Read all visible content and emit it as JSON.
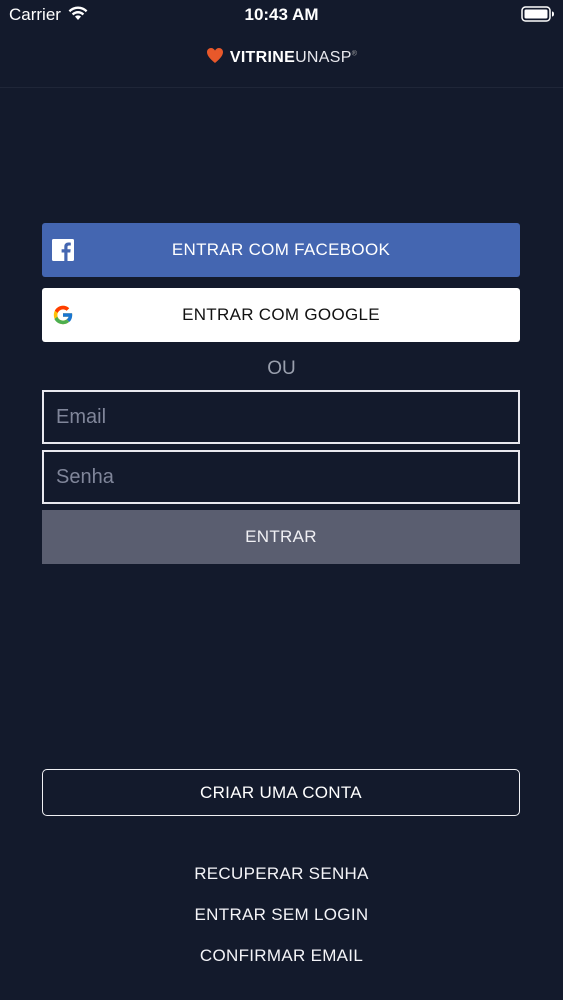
{
  "status_bar": {
    "carrier": "Carrier",
    "time": "10:43 AM",
    "wifi_icon": "wifi-icon",
    "battery_icon": "battery-icon"
  },
  "header": {
    "logo_icon": "heart-logo-icon",
    "logo_bold": "VITRINE",
    "logo_light": "UNASP",
    "logo_sup": "®",
    "accent_color": "#e8582a"
  },
  "login": {
    "facebook_label": "ENTRAR COM FACEBOOK",
    "facebook_icon": "facebook-icon",
    "facebook_color": "#4466b1",
    "google_label": "ENTRAR COM GOOGLE",
    "google_icon": "google-icon",
    "divider_text": "OU",
    "email_placeholder": "Email",
    "password_placeholder": "Senha",
    "submit_label": "ENTRAR"
  },
  "footer": {
    "create_account_label": "CRIAR UMA CONTA",
    "recover_password_label": "RECUPERAR SENHA",
    "guest_login_label": "ENTRAR SEM LOGIN",
    "confirm_email_label": "CONFIRMAR EMAIL"
  }
}
